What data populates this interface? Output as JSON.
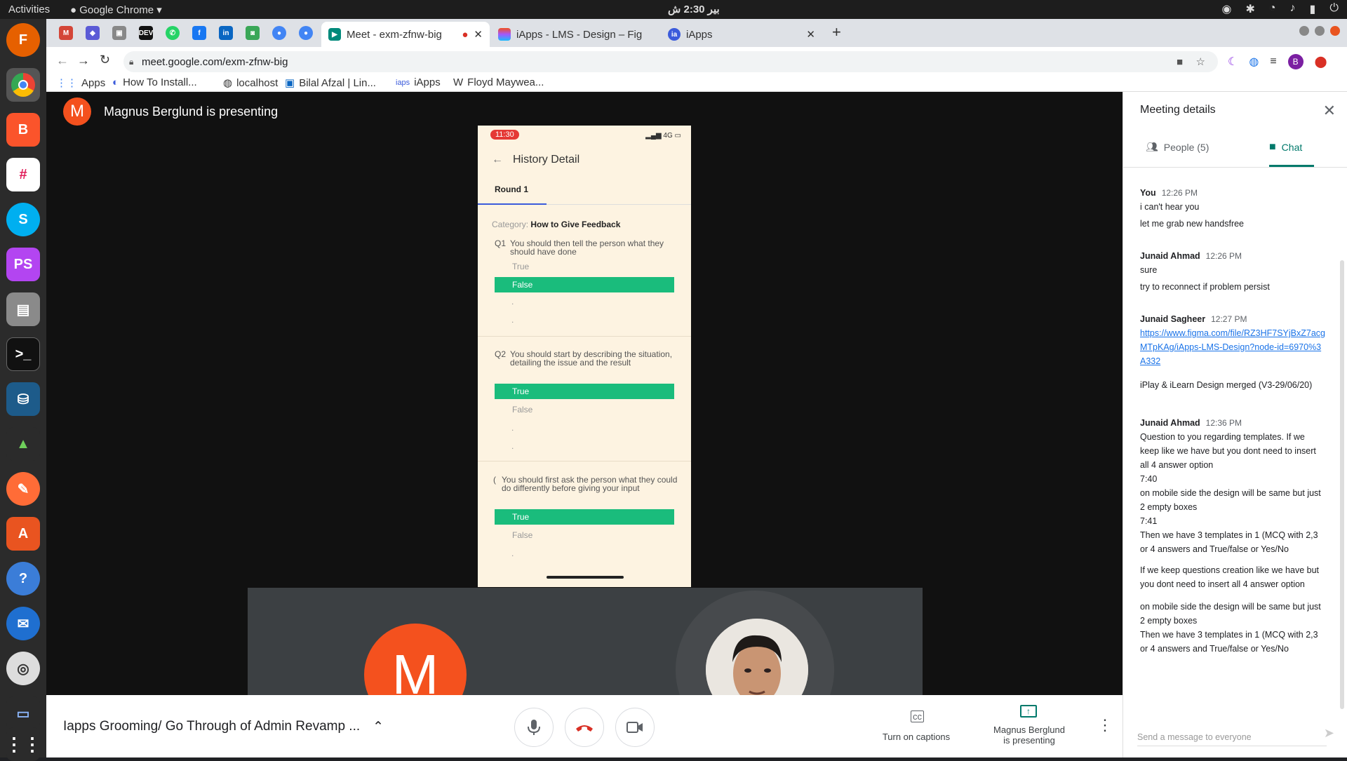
{
  "os": {
    "activities": "Activities",
    "app_name": "Google Chrome",
    "clock": "بیر 2:30 ش"
  },
  "browser": {
    "tabs": [
      {
        "title": "Meet - exm-zfnw-big",
        "active": true
      },
      {
        "title": "iApps - LMS - Design – Fig",
        "active": false
      },
      {
        "title": "iApps",
        "active": false
      }
    ],
    "url": "meet.google.com/exm-zfnw-big",
    "profile_initial": "B",
    "bookmarks": [
      "Apps",
      "How To Install...",
      "localhost",
      "Bilal Afzal | Lin...",
      "iApps",
      "Floyd Maywea..."
    ]
  },
  "meet": {
    "presenter_initial": "M",
    "presenter_text": "Magnus Berglund is presenting",
    "meeting_title": "Iapps Grooming/ Go Through of Admin Revamp ...",
    "captions_label": "Turn on captions",
    "presenting_label_1": "Magnus Berglund",
    "presenting_label_2": "is presenting",
    "tile_initial": "M"
  },
  "phone": {
    "time": "11:30",
    "network": "4G",
    "title": "History Detail",
    "round_tab": "Round 1",
    "category_label": "Category:",
    "category_value": "How to Give Feedback",
    "q1_num": "Q1",
    "q1_text": "You should then tell the person what they should have done",
    "q1_true": "True",
    "q1_false": "False",
    "q2_num": "Q2",
    "q2_text": "You should start by describing the situation, detailing the issue and the result",
    "q2_true": "True",
    "q2_false": "False",
    "q3_num": "(",
    "q3_text": "You should first ask the person what they could do differently before giving your input",
    "q3_true": "True",
    "q3_false": "False",
    "dot": "."
  },
  "panel": {
    "title": "Meeting details",
    "people_tab": "People (5)",
    "chat_tab": "Chat",
    "send_placeholder": "Send a message to everyone",
    "messages": [
      {
        "author": "You",
        "time": "12:26 PM",
        "lines": [
          "i can't hear you",
          "let me grab new handsfree"
        ]
      },
      {
        "author": "Junaid Ahmad",
        "time": "12:26 PM",
        "lines": [
          "sure",
          "try to reconnect if problem persist"
        ]
      },
      {
        "author": "Junaid Sagheer",
        "time": "12:27 PM",
        "link": "https://www.figma.com/file/RZ3HF7SYjBxZ7acgMTpKAg/iApps-LMS-Design?node-id=6970%3A332",
        "lines": [
          "iPlay & iLearn Design merged (V3-29/06/20)"
        ]
      },
      {
        "author": "Junaid Ahmad",
        "time": "12:36 PM",
        "lines": [
          "Question to you regarding templates. If we keep like we have but you dont need to insert all 4 answer option",
          "7:40",
          "on mobile side the design will be same but just 2 empty boxes",
          "7:41",
          "Then we have 3 templates in 1 (MCQ with 2,3 or 4 answers and True/false or Yes/No",
          "If we keep questions creation like we have but you dont need to insert all 4 answer option",
          "on mobile side the design will be same but just 2 empty boxes",
          "Then we have 3 templates in 1 (MCQ with 2,3 or 4 answers and True/false or Yes/No"
        ]
      }
    ]
  },
  "colors": {
    "accent": "#00796b",
    "selected_option": "#1abc7c",
    "avatar": "#f4511e",
    "hangup": "#d93025"
  }
}
